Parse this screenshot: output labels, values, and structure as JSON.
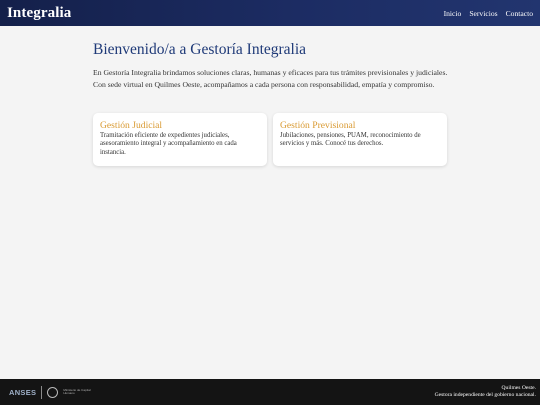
{
  "header": {
    "brand": "Integralia",
    "nav": [
      {
        "label": "Inicio"
      },
      {
        "label": "Servicios"
      },
      {
        "label": "Contacto"
      }
    ]
  },
  "main": {
    "title": "Bienvenido/a a Gestoría Integralia",
    "intro": "En Gestoría Integralia brindamos soluciones claras, humanas y eficaces para tus trámites previsionales y judiciales. Con sede virtual en Quilmes Oeste, acompañamos a cada persona con responsabilidad, empatía y compromiso."
  },
  "cards": [
    {
      "title": "Gestión Judicial",
      "text": "Tramitación eficiente de expedientes judiciales, asesoramiento integral y acompañamiento en cada instancia."
    },
    {
      "title": "Gestión Previsional",
      "text": "Jubilaciones, pensiones, PUAM, reconocimiento de servicios y más. Conocé tus derechos."
    }
  ],
  "footer": {
    "logo_anses": "ANSES",
    "logo_ministry": "Ministerio de Capital Humano",
    "location": "Quilmes Oeste.",
    "disclaimer": "Gestora independiente del gobierno nacional."
  },
  "colors": {
    "header_bg": "#1c2c63",
    "title": "#1f3a78",
    "card_title": "#d99a32",
    "footer_bg": "#141414"
  }
}
